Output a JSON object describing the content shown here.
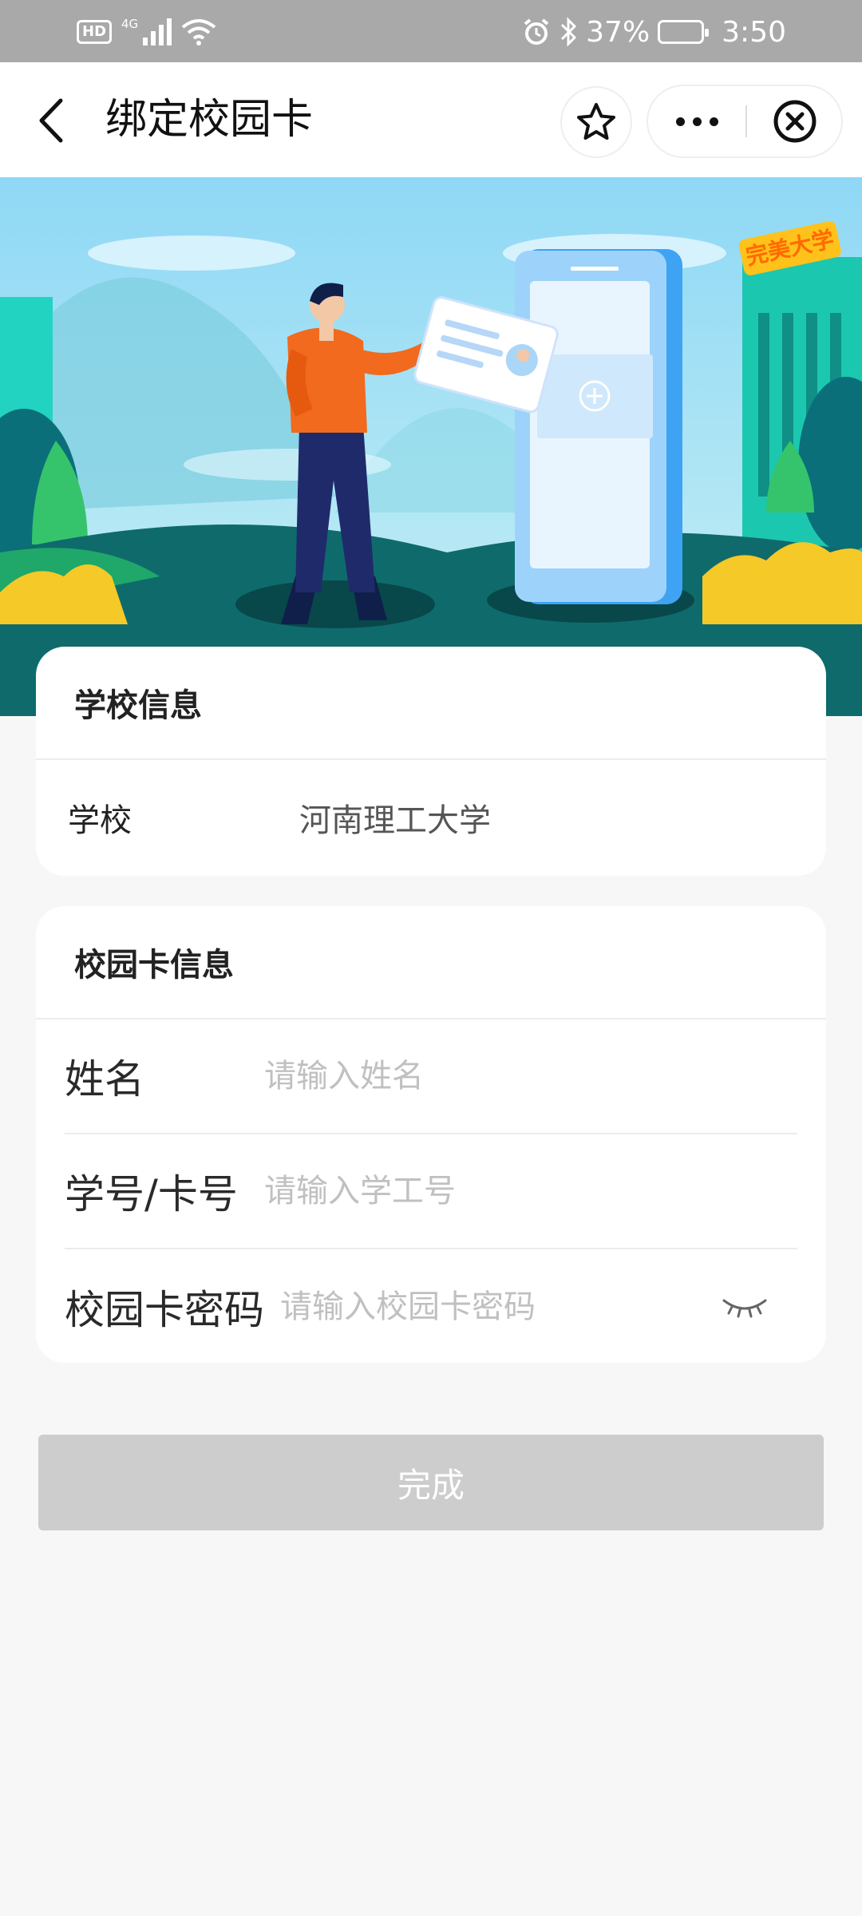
{
  "status_bar": {
    "network_badge": "HD",
    "signal_type": "4G",
    "battery": "37%",
    "time": "3:50",
    "icons": [
      "hd-icon",
      "signal-icon",
      "wifi-icon",
      "alarm-icon",
      "bluetooth-icon",
      "battery-icon"
    ]
  },
  "nav": {
    "title": "绑定校园卡",
    "icons": [
      "back-arrow-icon",
      "star-icon",
      "more-dots-icon",
      "close-circle-icon"
    ]
  },
  "banner": {
    "badge_text": "完美大学"
  },
  "school_card": {
    "heading": "学校信息",
    "school_label": "学校",
    "school_value": "河南理工大学"
  },
  "card_card": {
    "heading": "校园卡信息",
    "fields": [
      {
        "label": "姓名",
        "placeholder": "请输入姓名",
        "value": ""
      },
      {
        "label": "学号/卡号",
        "placeholder": "请输入学工号",
        "value": ""
      },
      {
        "label": "校园卡密码",
        "placeholder": "请输入校园卡密码",
        "value": ""
      }
    ],
    "password_toggle_icon": "eye-closed-icon"
  },
  "submit": {
    "label": "完成"
  },
  "colors": {
    "status_bar": "#a9a9a9",
    "page_bg": "#f7f7f7",
    "button_disabled": "#cdcdcd",
    "banner_sky": "#9fe0f2",
    "banner_ground": "#0f6b6b"
  }
}
